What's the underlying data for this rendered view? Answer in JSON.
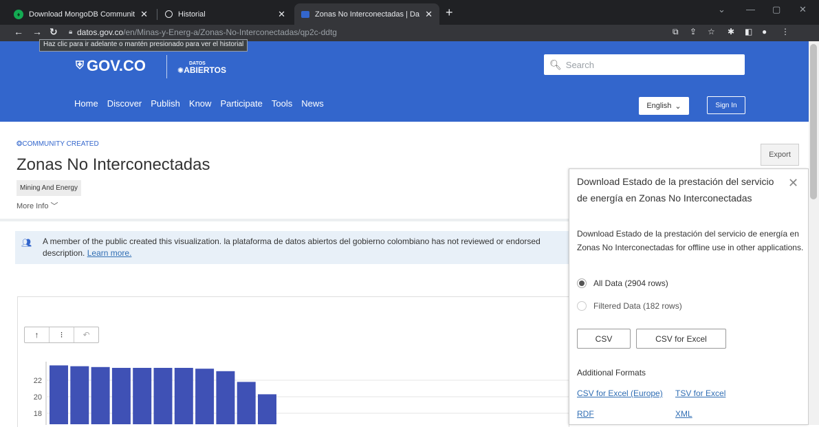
{
  "browser": {
    "tabs": [
      {
        "title": "Download MongoDB Communit",
        "favicon": "mongodb-leaf",
        "active": false
      },
      {
        "title": "Historial",
        "favicon": "history-clock",
        "active": false
      },
      {
        "title": "Zonas No Interconectadas | Dato",
        "favicon": "datos-gov",
        "active": true
      }
    ],
    "url_host": "datos.gov.co",
    "url_path": "/en/Minas-y-Energ-a/Zonas-No-Interconectadas/qp2c-ddtg",
    "tooltip": "Haz clic para ir adelante o mantén presionado para ver el historial"
  },
  "header": {
    "logo_text": "GOV.CO",
    "datos_small": "DATOS",
    "datos_big": "ABIERTOS",
    "search_placeholder": "Search",
    "nav": [
      "Home",
      "Discover",
      "Publish",
      "Know",
      "Participate",
      "Tools",
      "News"
    ],
    "language": "English",
    "sign_in": "Sign In"
  },
  "dataset": {
    "community_label": "COMMUNITY CREATED",
    "title": "Zonas No Interconectadas",
    "category": "Mining And Energy",
    "more_info": "More Info",
    "export_label": "Export"
  },
  "notice": {
    "text": "A member of the public created this visualization. la plataforma de datos abiertos del gobierno colombiano has not reviewed or endorsed",
    "text2": "description.",
    "link": "Learn more."
  },
  "chart_data": {
    "type": "bar",
    "y_tick_labels": [
      "22",
      "20",
      "18"
    ],
    "values": [
      23.8,
      23.7,
      23.6,
      23.5,
      23.5,
      23.5,
      23.5,
      23.4,
      23.1,
      21.8,
      20.3
    ],
    "visible_ymin": 17.5,
    "bar_color": "#3f51b5"
  },
  "panel": {
    "title": "Download Estado de la prestación del servicio de energía en Zonas No Interconectadas",
    "description": "Download Estado de la prestación del servicio de energía en Zonas No Interconectadas for offline use in other applications.",
    "option_all": "All Data (2904 rows)",
    "option_filtered": "Filtered Data (182 rows)",
    "btn_csv": "CSV",
    "btn_csv_excel": "CSV for Excel",
    "additional_formats": "Additional Formats",
    "link_csv_europe": "CSV for Excel (Europe)",
    "link_tsv": "TSV for Excel",
    "link_rdf": "RDF",
    "link_xml": "XML"
  }
}
